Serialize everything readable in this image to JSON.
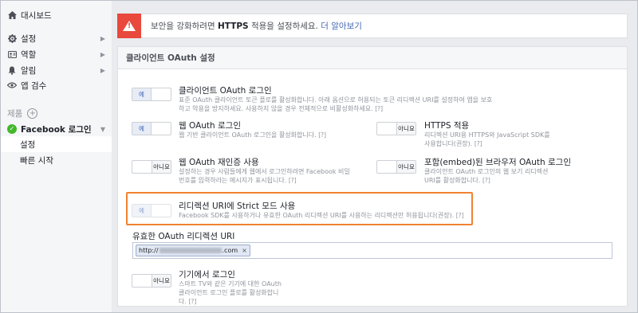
{
  "sidebar": {
    "dashboard": "대시보드",
    "settings": "설정",
    "roles": "역할",
    "alerts": "알림",
    "app_review": "앱 검수",
    "products_label": "제품",
    "product_name": "Facebook 로그인",
    "sub_settings": "설정",
    "sub_quickstart": "빠른 시작"
  },
  "alert": {
    "text_before": "보안을 강화하려면",
    "text_bold": "HTTPS",
    "text_after": "적용을 설정하세요.",
    "link": "더 알아보기"
  },
  "panel": {
    "title": "클라이언트 OAuth 설정"
  },
  "toggle_labels": {
    "yes": "예",
    "no": "아니요"
  },
  "options": {
    "client_oauth": {
      "title": "클라이언트 OAuth 로그인",
      "desc": "표준 OAuth 클라이언트 토큰 플로를 활성화합니다. 아래 옵션으로 허용되는 토큰 리디렉션 URI를 설정하여 앱을 보호하고 악용을 방지하세요. 사용하지 않을 경우 전체적으로 비활성화하세요.",
      "help": "[?]",
      "value": "on"
    },
    "web_oauth": {
      "title": "웹 OAuth 로그인",
      "desc": "웹 기반 클라이언트 OAuth 로그인을 활성화합니다.",
      "help": "[?]",
      "value": "on"
    },
    "https": {
      "title": "HTTPS 적용",
      "desc": "리디렉션 URI용 HTTPS와 JavaScript SDK를 사용합니다(권장).",
      "help": "[?]",
      "value": "off"
    },
    "reauth": {
      "title": "웹 OAuth 재인증 사용",
      "desc": "설정하는 경우 사람들에게 웹에서 로그인하려면 Facebook 비밀번호를 입력하라는 메시지가 표시됩니다.",
      "help": "[?]",
      "value": "off"
    },
    "embedded": {
      "title": "포함(embed)된 브라우저 OAuth 로그인",
      "desc": "클라이언트 OAuth 로그인의 웹 보기 리디렉션 URI를 활성화합니다.",
      "help": "[?]",
      "value": "off"
    },
    "strict": {
      "title": "리디렉션 URI에 Strict 모드 사용",
      "desc": "Facebook SDK를 사용하거나 유효한 OAuth 리디렉션 URI를 사용하는 리디렉션만 허용됩니다(권장).",
      "help": "[?]",
      "value": "on"
    },
    "device": {
      "title": "기기에서 로그인",
      "desc": "스마트 TV와 같은 기기에 대한 OAuth 클라이언트 로그인 플로를 활성화합니다.",
      "help": "[?]",
      "value": "off"
    }
  },
  "valid_uri": {
    "label": "유효한 OAuth 리디렉션 URI",
    "token_prefix": "http://",
    "token_suffix": ".com",
    "remove": "×"
  }
}
